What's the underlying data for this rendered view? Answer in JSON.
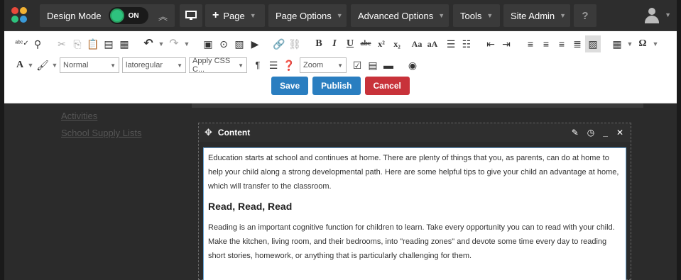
{
  "topbar": {
    "design_mode_label": "Design Mode",
    "toggle_label": "ON",
    "page_label": "Page",
    "page_options_label": "Page Options",
    "advanced_options_label": "Advanced Options",
    "tools_label": "Tools",
    "site_admin_label": "Site Admin",
    "help_label": "?"
  },
  "toolbar": {
    "style_select": "Normal",
    "font_select": "latoregular",
    "css_select": "Apply CSS C...",
    "zoom_select": "Zoom",
    "save_label": "Save",
    "publish_label": "Publish",
    "cancel_label": "Cancel"
  },
  "sidebar": {
    "items": [
      {
        "label": "Activities"
      },
      {
        "label": "School Supply Lists"
      }
    ]
  },
  "module": {
    "title": "Content",
    "paragraph1": "Education starts at school and continues at home. There are plenty of things that you, as parents, can do at home to help your child along a strong developmental path. Here are some helpful tips to give your child an advantage at home, which will transfer to the classroom.",
    "heading": "Read, Read, Read",
    "paragraph2": "Reading is an important cognitive function for children to learn. Take every opportunity you can to read with your child. Make the kitchen, living room, and their bedrooms, into \"reading zones\" and devote some time every day to reading short stories, homework, or anything that is particularly challenging for them."
  },
  "colors": {
    "accent_blue": "#2a7ec0",
    "cancel_red": "#c8323a",
    "toggle_green": "#2ec27e"
  }
}
